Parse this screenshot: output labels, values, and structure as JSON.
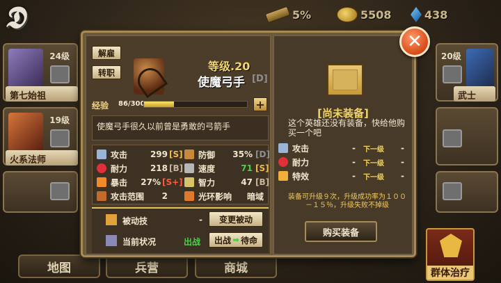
{
  "resources": {
    "scroll_percent": "5%",
    "gold": "5508",
    "gems": "438"
  },
  "logo_text": "",
  "side_heroes_left": [
    {
      "level": "24级",
      "name": "第七始祖"
    },
    {
      "level": "19级",
      "name": "火系法师"
    }
  ],
  "side_heroes_right": [
    {
      "level": "20级",
      "name": "武士"
    }
  ],
  "bottom_nav": {
    "map": "地图",
    "barracks": "兵营",
    "shop": "商城",
    "group_heal": "群体治疗"
  },
  "hero": {
    "dismiss_label": "解雇",
    "transfer_label": "转职",
    "level_text": "等级.20",
    "name": "使魔弓手",
    "grade": "[D]",
    "exp_label": "经验",
    "exp_value": "86/300",
    "exp_progress": 0.29,
    "plus_label": "+",
    "description": "使魔弓手很久以前曾是勇敢的弓箭手",
    "stats": {
      "attack": {
        "label": "攻击",
        "value": "299",
        "grade": "[S]"
      },
      "defense": {
        "label": "防御",
        "value": "35%",
        "grade": "[D]"
      },
      "hp": {
        "label": "耐力",
        "value": "218",
        "grade": "[B]"
      },
      "speed": {
        "label": "速度",
        "value": "71",
        "grade": "[S]"
      },
      "crit": {
        "label": "暴击",
        "value": "27%",
        "grade": "[S+]"
      },
      "intel": {
        "label": "智力",
        "value": "47",
        "grade": "[B]"
      },
      "range": {
        "label": "攻击范围",
        "value": "2"
      },
      "aura": {
        "label": "光环影响",
        "value": "暗域"
      }
    },
    "passive_label": "被动技",
    "passive_value": "-",
    "change_passive_label": "变更被动",
    "status_label": "当前状况",
    "status_value": "出战",
    "status_button": {
      "from": "出战",
      "arrow": "➡",
      "to": "待命"
    }
  },
  "equipment": {
    "title": "[尚未装备]",
    "description": "这个英雄还没有装备，快给他购买一个吧",
    "rows": [
      {
        "label": "攻击",
        "value": "-",
        "next": "下一级",
        "next_value": "-"
      },
      {
        "label": "耐力",
        "value": "-",
        "next": "下一级",
        "next_value": "-"
      },
      {
        "label": "特效",
        "value": "-",
        "next": "下一级",
        "next_value": "-"
      }
    ],
    "upgrade_info": "装备可升级９次，升级成功率为１００－１５％，升级失败不掉级",
    "buy_label": "购买装备"
  },
  "colors": {
    "accent_gold": "#f3d46a",
    "grade_s": "#f3b94a",
    "grade_splus": "#ff5a3a",
    "grade_d": "#8f8f8f",
    "status_green": "#4cd04a"
  }
}
